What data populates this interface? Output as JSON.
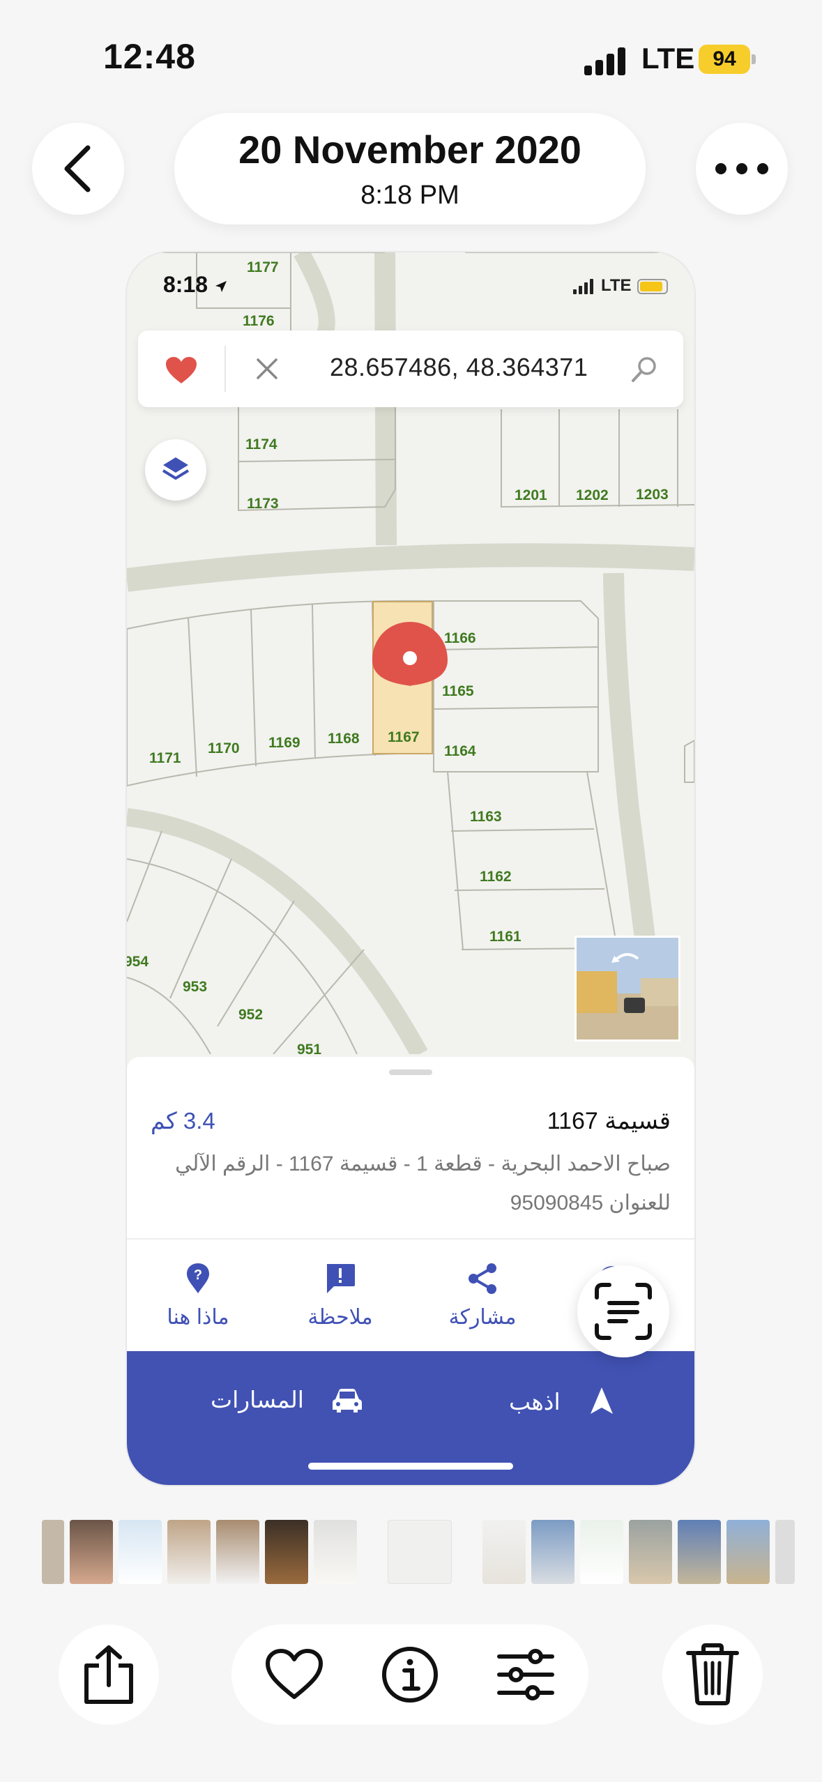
{
  "status_bar": {
    "time": "12:48",
    "network": "LTE",
    "battery": "94"
  },
  "header": {
    "date": "20 November 2020",
    "time": "8:18 PM"
  },
  "embedded": {
    "status": {
      "time": "8:18",
      "network": "LTE"
    },
    "search": {
      "coordinates": "28.657486, 48.364371"
    },
    "map_labels": {
      "p1177": "1177",
      "p1176": "1176",
      "p1174": "1174",
      "p1173": "1173",
      "p1201": "1201",
      "p1202": "1202",
      "p1203": "1203",
      "p1166": "1166",
      "p1165": "1165",
      "p1164": "1164",
      "p1171": "1171",
      "p1170": "1170",
      "p1169": "1169",
      "p1168": "1168",
      "p1167": "1167",
      "p1163": "1163",
      "p1162": "1162",
      "p1161": "1161",
      "p954": "954",
      "p953": "953",
      "p952": "952",
      "p951": "951"
    },
    "sheet": {
      "title": "قسيمة 1167",
      "distance": "3.4 كم",
      "address": "صباح الاحمد البحرية - قطعة 1 - قسيمة 1167 - الرقم الآلي للعنوان 95090845",
      "actions": [
        {
          "label": "ماذا هنا",
          "icon": "help-pin-icon"
        },
        {
          "label": "ملاحظة",
          "icon": "note-icon"
        },
        {
          "label": "مشاركة",
          "icon": "share-icon"
        }
      ],
      "go_label": "اذهب",
      "routes_label": "المسارات"
    }
  },
  "colors": {
    "accent": "#4152b3",
    "parcel_highlight": "#f6e2b3",
    "plot_label": "#3f7a1f",
    "pin": "#e0534a"
  }
}
